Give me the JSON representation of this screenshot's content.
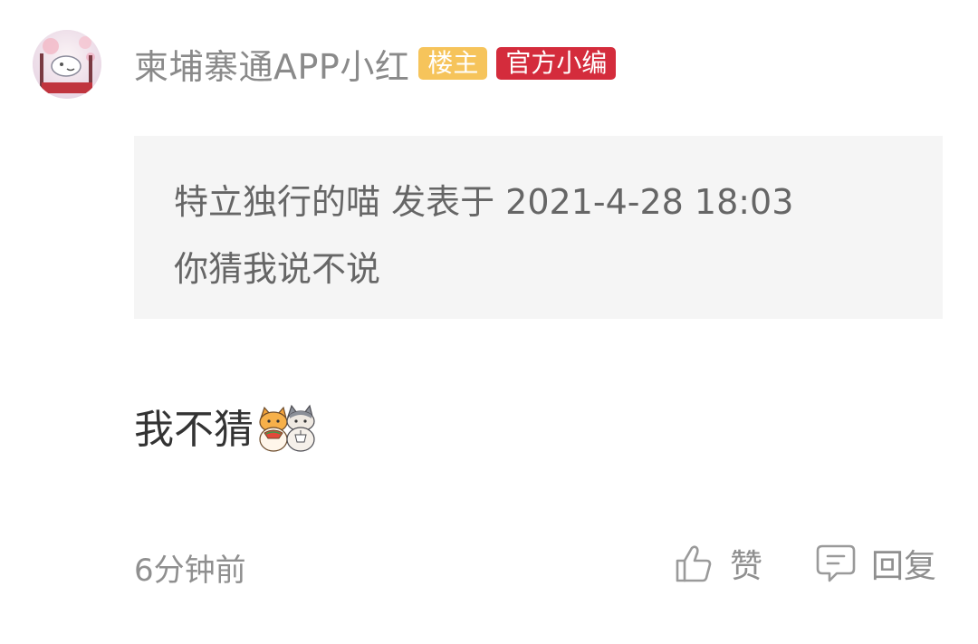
{
  "post": {
    "author": {
      "name": "柬埔寨通APP小红",
      "avatar_icon": "avatar-illustration",
      "badges": [
        {
          "label": "楼主",
          "color": "#f6c45b"
        },
        {
          "label": "官方小编",
          "color": "#d42c3c"
        }
      ]
    },
    "quote": {
      "meta": "特立独行的喵 发表于 2021-4-28 18:03",
      "text": "你猜我说不说"
    },
    "comment": {
      "text": "我不猜",
      "sticker_icon": "cats-sticker"
    },
    "footer": {
      "time": "6分钟前",
      "like_label": "赞",
      "like_icon": "thumbs-up-icon",
      "reply_label": "回复",
      "reply_icon": "chat-bubble-icon"
    }
  }
}
